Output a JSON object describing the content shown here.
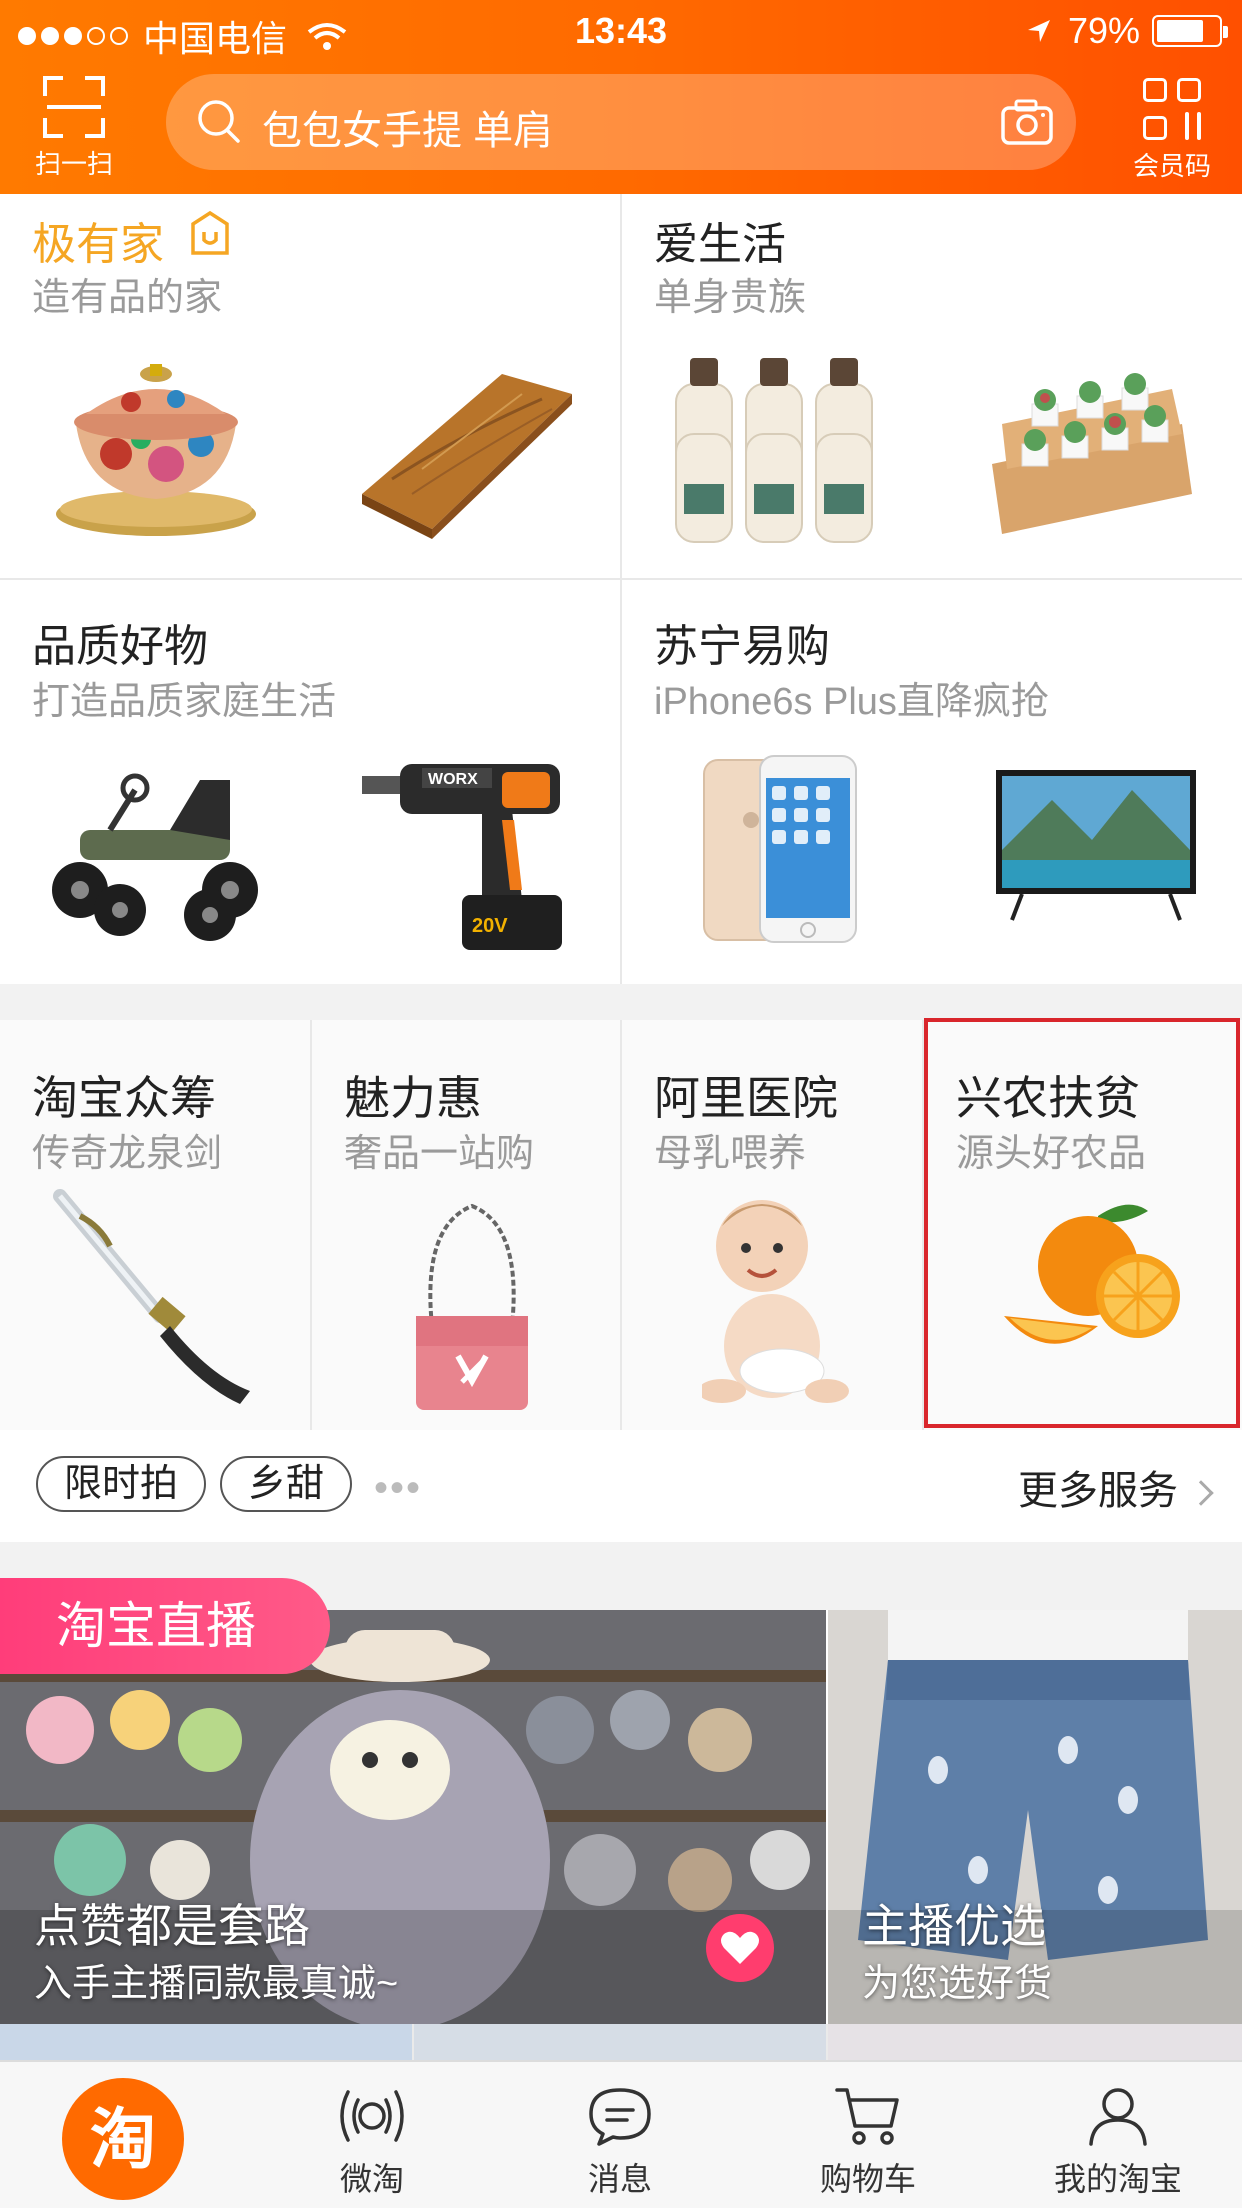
{
  "status_bar": {
    "carrier": "中国电信",
    "time": "13:43",
    "battery": "79%"
  },
  "header": {
    "scan_label": "扫一扫",
    "search_placeholder": "包包女手提 单肩",
    "member_label": "会员码"
  },
  "cards_top": [
    {
      "title": "极有家",
      "subtitle": "造有品的家"
    },
    {
      "title": "爱生活",
      "subtitle": "单身贵族"
    },
    {
      "title": "品质好物",
      "subtitle": "打造品质家庭生活"
    },
    {
      "title": "苏宁易购",
      "subtitle": "iPhone6s Plus直降疯抢"
    }
  ],
  "cards_small": [
    {
      "title": "淘宝众筹",
      "subtitle": "传奇龙泉剑"
    },
    {
      "title": "魅力惠",
      "subtitle": "奢品一站购"
    },
    {
      "title": "阿里医院",
      "subtitle": "母乳喂养"
    },
    {
      "title": "兴农扶贫",
      "subtitle": "源头好农品"
    }
  ],
  "tags": {
    "tag1": "限时拍",
    "tag2": "乡甜",
    "dots": "•••",
    "more_services": "更多服务"
  },
  "live": {
    "badge": "淘宝直播",
    "main_title": "点赞都是套路",
    "main_sub": "入手主播同款最真诚~",
    "side_title": "主播优选",
    "side_sub": "为您选好货"
  },
  "tabbar": {
    "home": "淘",
    "weitao": "微淘",
    "messages": "消息",
    "cart": "购物车",
    "mine": "我的淘宝"
  },
  "colors": {
    "brand_orange": "#ff6a00",
    "live_pink": "#ff3d7a",
    "highlight_red": "#d9262c",
    "jiyoujia_gold": "#f5a623"
  },
  "icons": [
    "scan-icon",
    "search-icon",
    "camera-icon",
    "member-code-icon",
    "home-tao-icon",
    "weitao-icon",
    "message-icon",
    "cart-icon",
    "profile-icon",
    "heart-icon",
    "chevron-right-icon"
  ]
}
